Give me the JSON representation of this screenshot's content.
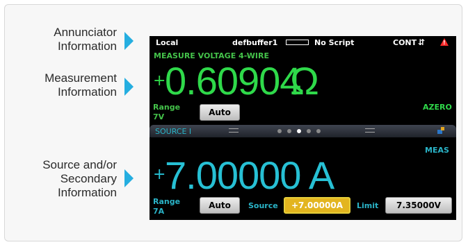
{
  "callouts": {
    "annunciator": [
      "Annunciator",
      "Information"
    ],
    "measurement": [
      "Measurement",
      "Information"
    ],
    "source": [
      "Source and/or",
      "Secondary",
      "Information"
    ]
  },
  "status_bar": {
    "mode": "Local",
    "buffer": "defbuffer1",
    "script": "No Script",
    "trigger": "CONT",
    "cycle_icon": "cycle-icon",
    "warning_icon": "warning-icon"
  },
  "measure": {
    "title": "MEASURE VOLTAGE 4-WIRE",
    "sign": "+",
    "value": "0.60904",
    "unit": "Ω",
    "range_label": "Range",
    "range_value": "7V",
    "range_button": "Auto",
    "azero": "AZERO"
  },
  "swipe": {
    "title": "SOURCE I",
    "dots": 5,
    "active_dot": 3
  },
  "source": {
    "meas": "MEAS",
    "sign": "+",
    "value": "7.00000 A",
    "range_label": "Range",
    "range_value": "7A",
    "range_button": "Auto",
    "source_label": "Source",
    "source_value": "+7.00000A",
    "limit_label": "Limit",
    "limit_value": "7.35000V"
  },
  "colors": {
    "arrow": "#25aee0",
    "measure_green": "#2fd94a",
    "source_cyan": "#27c0d4",
    "source_field": "#e3b51f"
  }
}
